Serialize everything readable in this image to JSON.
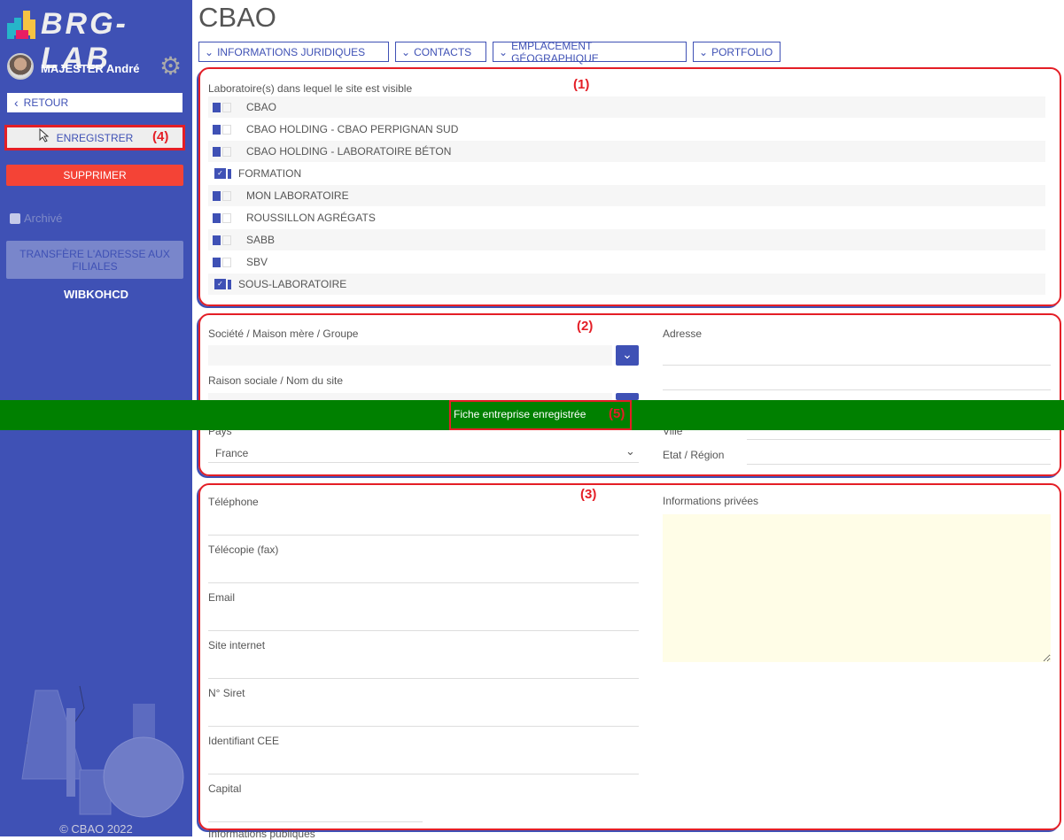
{
  "sidebar": {
    "logo": "BRG-LAB",
    "user": "MAJESTER André",
    "retour": "RETOUR",
    "enregistrer": "ENREGISTRER",
    "supprimer": "SUPPRIMER",
    "archive": "Archivé",
    "transfer": "TRANSFÈRE L'ADRESSE AUX FILIALES",
    "code": "WIBKOHCD",
    "copyright": "© CBAO 2022"
  },
  "annotations": {
    "a1": "(1)",
    "a2": "(2)",
    "a3": "(3)",
    "a4": "(4)",
    "a5": "(5)"
  },
  "page": {
    "title": "CBAO"
  },
  "tabs": [
    "INFORMATIONS JURIDIQUES",
    "CONTACTS",
    "EMPLACEMENT GÉOGRAPHIQUE",
    "PORTFOLIO"
  ],
  "labs": {
    "label": "Laboratoire(s) dans lequel le site est visible",
    "items": [
      {
        "name": "CBAO",
        "checked": false
      },
      {
        "name": "CBAO HOLDING - CBAO PERPIGNAN SUD",
        "checked": false
      },
      {
        "name": "CBAO HOLDING - LABORATOIRE BÉTON",
        "checked": false
      },
      {
        "name": "FORMATION",
        "checked": true
      },
      {
        "name": "MON LABORATOIRE",
        "checked": false
      },
      {
        "name": "ROUSSILLON AGRÉGATS",
        "checked": false
      },
      {
        "name": "SABB",
        "checked": false
      },
      {
        "name": "SBV",
        "checked": false
      },
      {
        "name": "SOUS-LABORATOIRE",
        "checked": true
      }
    ]
  },
  "address": {
    "societe": "Société / Maison mère / Groupe",
    "raison": "Raison sociale / Nom du site",
    "pays": "Pays",
    "pays_value": "France",
    "adresse": "Adresse",
    "ville": "Ville",
    "etat": "Etat / Région"
  },
  "toast": "Fiche entreprise enregistrée",
  "contact": {
    "fields": [
      "Téléphone",
      "Télécopie (fax)",
      "Email",
      "Site internet",
      "N° Siret",
      "Identifiant CEE",
      "Capital"
    ],
    "private": "Informations privées",
    "public": "Informations publiques"
  },
  "colors": {
    "primary": "#3f51b5",
    "danger": "#f44336",
    "success": "#008000",
    "annotation": "#e41e26"
  }
}
